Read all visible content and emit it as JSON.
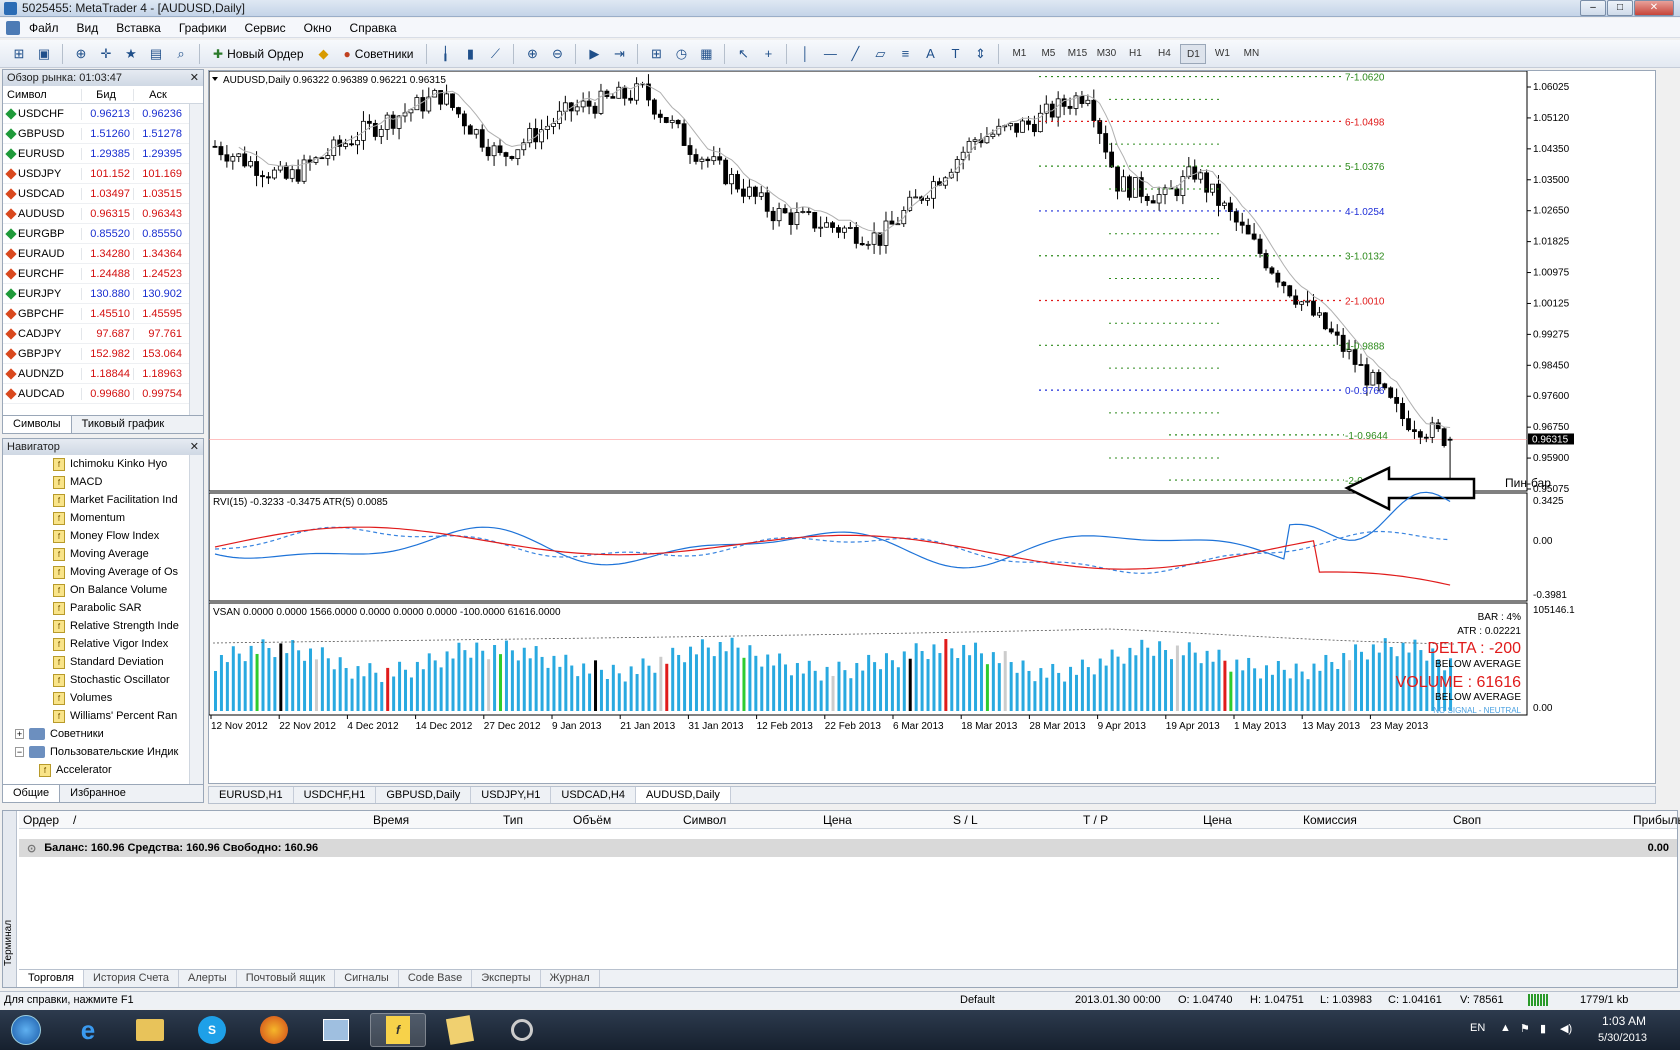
{
  "window": {
    "title": "5025455: MetaTrader 4 - [AUDUSD,Daily]"
  },
  "menu": [
    "Файл",
    "Вид",
    "Вставка",
    "Графики",
    "Сервис",
    "Окно",
    "Справка"
  ],
  "toolbar": {
    "new_order": "Новый Ордер",
    "advisors": "Советники",
    "timeframes": [
      "M1",
      "M5",
      "M15",
      "M30",
      "H1",
      "H4",
      "D1",
      "W1",
      "MN"
    ],
    "active_tf": "D1"
  },
  "market_watch": {
    "title": "Обзор рынка: 01:03:47",
    "headers": [
      "Символ",
      "Бид",
      "Аск"
    ],
    "rows": [
      {
        "sym": "USDCHF",
        "bid": "0.96213",
        "ask": "0.96236",
        "dir": "up",
        "color": "blue"
      },
      {
        "sym": "GBPUSD",
        "bid": "1.51260",
        "ask": "1.51278",
        "dir": "up",
        "color": "blue"
      },
      {
        "sym": "EURUSD",
        "bid": "1.29385",
        "ask": "1.29395",
        "dir": "up",
        "color": "blue"
      },
      {
        "sym": "USDJPY",
        "bid": "101.152",
        "ask": "101.169",
        "dir": "dn",
        "color": "red"
      },
      {
        "sym": "USDCAD",
        "bid": "1.03497",
        "ask": "1.03515",
        "dir": "dn",
        "color": "red"
      },
      {
        "sym": "AUDUSD",
        "bid": "0.96315",
        "ask": "0.96343",
        "dir": "dn",
        "color": "red"
      },
      {
        "sym": "EURGBP",
        "bid": "0.85520",
        "ask": "0.85550",
        "dir": "up",
        "color": "blue"
      },
      {
        "sym": "EURAUD",
        "bid": "1.34280",
        "ask": "1.34364",
        "dir": "dn",
        "color": "red"
      },
      {
        "sym": "EURCHF",
        "bid": "1.24488",
        "ask": "1.24523",
        "dir": "dn",
        "color": "red"
      },
      {
        "sym": "EURJPY",
        "bid": "130.880",
        "ask": "130.902",
        "dir": "up",
        "color": "blue"
      },
      {
        "sym": "GBPCHF",
        "bid": "1.45510",
        "ask": "1.45595",
        "dir": "dn",
        "color": "red"
      },
      {
        "sym": "CADJPY",
        "bid": "97.687",
        "ask": "97.761",
        "dir": "dn",
        "color": "red"
      },
      {
        "sym": "GBPJPY",
        "bid": "152.982",
        "ask": "153.064",
        "dir": "dn",
        "color": "red"
      },
      {
        "sym": "AUDNZD",
        "bid": "1.18844",
        "ask": "1.18963",
        "dir": "dn",
        "color": "red"
      },
      {
        "sym": "AUDCAD",
        "bid": "0.99680",
        "ask": "0.99754",
        "dir": "dn",
        "color": "red"
      }
    ],
    "tabs": [
      "Символы",
      "Тиковый график"
    ]
  },
  "navigator": {
    "title": "Навигатор",
    "items": [
      "Ichimoku Kinko Hyo",
      "MACD",
      "Market Facilitation Ind",
      "Momentum",
      "Money Flow Index",
      "Moving Average",
      "Moving Average of Os",
      "On Balance Volume",
      "Parabolic SAR",
      "Relative Strength Inde",
      "Relative Vigor Index",
      "Standard Deviation",
      "Stochastic Oscillator",
      "Volumes",
      "Williams' Percent Ran"
    ],
    "group1": "Советники",
    "group2": "Пользовательские Индик",
    "sub": "Accelerator",
    "tabs": [
      "Общие",
      "Избранное"
    ]
  },
  "chart": {
    "header": "AUDUSD,Daily  0.96322 0.96389 0.96221 0.96315",
    "price_ticks": [
      "1.06025",
      "1.05120",
      "1.04350",
      "1.03500",
      "1.02650",
      "1.01825",
      "1.00975",
      "1.00125",
      "0.99275",
      "0.98450",
      "0.97600",
      "0.96750",
      "0.95900",
      "0.95075"
    ],
    "current_price": "0.96315",
    "fib_levels": [
      {
        "label": "7-1.0620",
        "color": "#2e8b1d"
      },
      {
        "label": "6-1.0498",
        "color": "#e01b1b"
      },
      {
        "label": "5-1.0376",
        "color": "#2e8b1d"
      },
      {
        "label": "4-1.0254",
        "color": "#1f2fd8"
      },
      {
        "label": "3-1.0132",
        "color": "#2e8b1d"
      },
      {
        "label": "2-1.0010",
        "color": "#e01b1b"
      },
      {
        "label": "1-0.9888",
        "color": "#2e8b1d"
      },
      {
        "label": "0-0.9766",
        "color": "#1f2fd8"
      },
      {
        "label": "-1-0.9644",
        "color": "#2e8b1d"
      },
      {
        "label": "-2-0.9521",
        "color": "#2e8b1d"
      }
    ],
    "annotation": "Пин-бар",
    "rvi_header": "RVI(15) -0.3233 -0.3475  ATR(5) 0.0085",
    "rvi_ticks": [
      "0.3425",
      "0.00",
      "-0.3981"
    ],
    "vsan_header": "VSAN 0.0000 0.0000 1566.0000 0.0000 0.0000 0.0000 -100.0000 61616.0000",
    "vsan_ticks": [
      "105146.1",
      "0.00"
    ],
    "vsan_stats": {
      "bar": "BAR : 4%",
      "atr": "ATR : 0.02221",
      "delta": "DELTA : -200",
      "below1": "BELOW AVERAGE",
      "volume": "VOLUME : 61616",
      "below2": "BELOW AVERAGE",
      "signal": "NO SIGNAL - NEUTRAL"
    },
    "dates": [
      "12 Nov 2012",
      "22 Nov 2012",
      "4 Dec 2012",
      "14 Dec 2012",
      "27 Dec 2012",
      "9 Jan 2013",
      "21 Jan 2013",
      "31 Jan 2013",
      "12 Feb 2013",
      "22 Feb 2013",
      "6 Mar 2013",
      "18 Mar 2013",
      "28 Mar 2013",
      "9 Apr 2013",
      "19 Apr 2013",
      "1 May 2013",
      "13 May 2013",
      "23 May 2013"
    ],
    "colors": {
      "bull": "#ffffff",
      "bear": "#000000",
      "volume": "#29a9e0",
      "rvi_main": "#1e73d8",
      "rvi_signal": "#e01b1b",
      "ma": "#b0b0b0"
    }
  },
  "chart_tabs": [
    "EURUSD,H1",
    "USDCHF,H1",
    "GBPUSD,Daily",
    "USDJPY,H1",
    "USDCAD,H4",
    "AUDUSD,Daily"
  ],
  "active_chart_tab": "AUDUSD,Daily",
  "terminal": {
    "side_label": "Терминал",
    "headers": [
      "Ордер",
      "/",
      "Время",
      "Тип",
      "Объём",
      "Символ",
      "Цена",
      "S / L",
      "T / P",
      "Цена",
      "Комиссия",
      "Своп",
      "Прибыль"
    ],
    "balance_row": "Баланс: 160.96  Средства: 160.96  Свободно: 160.96",
    "profit": "0.00",
    "tabs": [
      "Торговля",
      "История Счета",
      "Алерты",
      "Почтовый ящик",
      "Сигналы",
      "Code Base",
      "Эксперты",
      "Журнал"
    ]
  },
  "status": {
    "help": "Для справки, нажмите F1",
    "profile": "Default",
    "time": "2013.01.30 00:00",
    "open": "O: 1.04740",
    "high": "H: 1.04751",
    "low": "L: 1.03983",
    "close": "C: 1.04161",
    "vol": "V: 78561",
    "traffic": "1779/1 kb"
  },
  "tray": {
    "lang": "EN",
    "clock": "1:03 AM",
    "date": "5/30/2013"
  }
}
